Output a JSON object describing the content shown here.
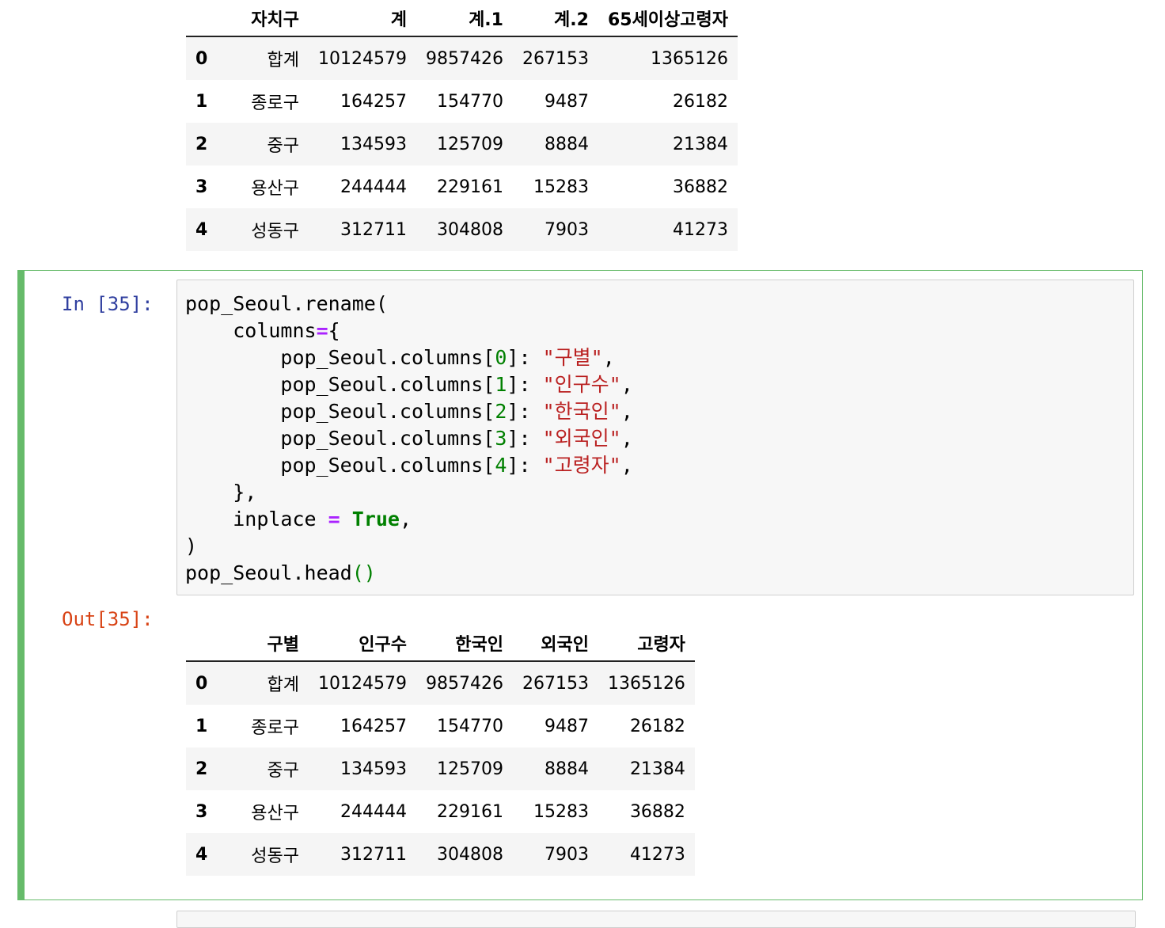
{
  "previous_output": {
    "columns": [
      "자치구",
      "계",
      "계.1",
      "계.2",
      "65세이상고령자"
    ],
    "rows": [
      {
        "index": "0",
        "cells": [
          "합계",
          "10124579",
          "9857426",
          "267153",
          "1365126"
        ]
      },
      {
        "index": "1",
        "cells": [
          "종로구",
          "164257",
          "154770",
          "9487",
          "26182"
        ]
      },
      {
        "index": "2",
        "cells": [
          "중구",
          "134593",
          "125709",
          "8884",
          "21384"
        ]
      },
      {
        "index": "3",
        "cells": [
          "용산구",
          "244444",
          "229161",
          "15283",
          "36882"
        ]
      },
      {
        "index": "4",
        "cells": [
          "성동구",
          "312711",
          "304808",
          "7903",
          "41273"
        ]
      }
    ]
  },
  "cell": {
    "in_prompt": "In [35]:",
    "out_prompt": "Out[35]:",
    "code": {
      "obj": "pop_Seoul",
      "rename_call": ".rename(",
      "columns_kw": "columns",
      "eq": "=",
      "lbrace": "{",
      "columns_attr": "pop_Seoul.columns[",
      "close_bracket": "]:",
      "indices": [
        "0",
        "1",
        "2",
        "3",
        "4"
      ],
      "new_names": [
        "\"구별\"",
        "\"인구수\"",
        "\"한국인\"",
        "\"외국인\"",
        "\"고령자\""
      ],
      "comma": ",",
      "rbrace_comma": "},",
      "inplace_kw": "inplace",
      "eq_spaced": "=",
      "true_kw": "True",
      "close_paren": ")",
      "head_call": "pop_Seoul.head",
      "head_parens": "()"
    }
  },
  "output": {
    "columns": [
      "구별",
      "인구수",
      "한국인",
      "외국인",
      "고령자"
    ],
    "rows": [
      {
        "index": "0",
        "cells": [
          "합계",
          "10124579",
          "9857426",
          "267153",
          "1365126"
        ]
      },
      {
        "index": "1",
        "cells": [
          "종로구",
          "164257",
          "154770",
          "9487",
          "26182"
        ]
      },
      {
        "index": "2",
        "cells": [
          "중구",
          "134593",
          "125709",
          "8884",
          "21384"
        ]
      },
      {
        "index": "3",
        "cells": [
          "용산구",
          "244444",
          "229161",
          "15283",
          "36882"
        ]
      },
      {
        "index": "4",
        "cells": [
          "성동구",
          "312711",
          "304808",
          "7903",
          "41273"
        ]
      }
    ]
  }
}
